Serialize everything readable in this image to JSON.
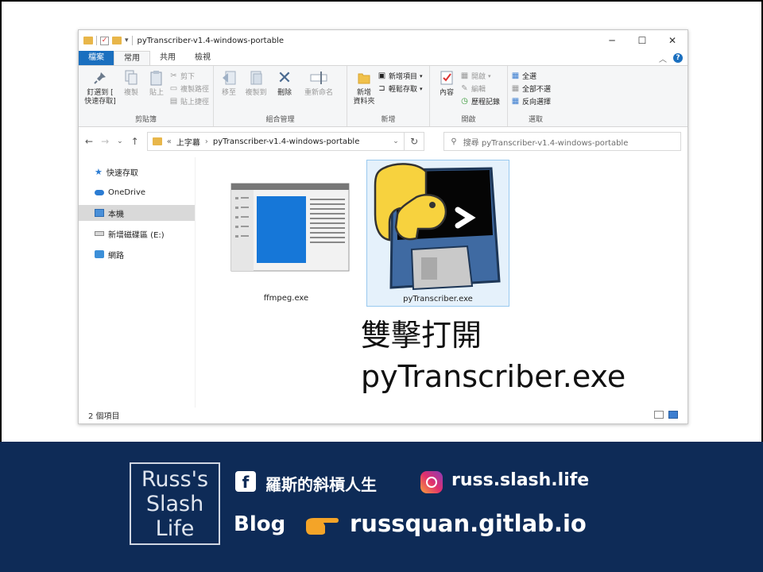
{
  "window": {
    "title": "pyTranscriber-v1.4-windows-portable",
    "controls": {
      "minimize": "─",
      "maximize": "☐",
      "close": "✕"
    }
  },
  "tabs": [
    {
      "label": "檔案"
    },
    {
      "label": "常用"
    },
    {
      "label": "共用"
    },
    {
      "label": "檢視"
    }
  ],
  "ribbon": {
    "clipboard": {
      "label": "剪貼簿",
      "pin": "釘選到 [\n快速存取]",
      "copy": "複製",
      "paste": "貼上",
      "cut": "剪下",
      "copy_path": "複製路徑",
      "paste_shortcut": "貼上捷徑"
    },
    "organize": {
      "label": "組合管理",
      "move_to": "移至",
      "copy_to": "複製到",
      "delete": "刪除",
      "rename": "重新命名"
    },
    "new": {
      "label": "新增",
      "new_folder": "新增\n資料夾",
      "new_item": "新增項目",
      "easy_access": "輕鬆存取"
    },
    "open": {
      "label": "開啟",
      "properties": "內容",
      "open": "開啟",
      "edit": "編輯",
      "history": "歷程記錄"
    },
    "select": {
      "label": "選取",
      "select_all": "全選",
      "select_none": "全部不選",
      "invert": "反向選擇"
    }
  },
  "address": {
    "breadcrumb_prefix": "«",
    "parent": "上字幕",
    "current": "pyTranscriber-v1.4-windows-portable",
    "search_placeholder": "搜尋 pyTranscriber-v1.4-windows-portable"
  },
  "nav_pane": [
    {
      "label": "快速存取",
      "icon": "star-icon"
    },
    {
      "label": "OneDrive",
      "icon": "cloud-icon"
    },
    {
      "label": "本機",
      "icon": "computer-icon"
    },
    {
      "label": "新增磁碟區 (E:)",
      "icon": "drive-icon"
    },
    {
      "label": "網路",
      "icon": "network-icon"
    }
  ],
  "files": [
    {
      "name": "ffmpeg.exe",
      "icon": "application-window-icon"
    },
    {
      "name": "pyTranscriber.exe",
      "icon": "python-floppy-icon"
    }
  ],
  "caption": {
    "line1": "雙擊打開",
    "line2": "pyTranscriber.exe"
  },
  "status": {
    "count": "2 個項目"
  },
  "banner": {
    "logo_line1": "Russ's",
    "logo_line2": "Slash",
    "logo_line3": "Life",
    "facebook_name": "羅斯的斜槓人生",
    "instagram_handle": "russ.slash.life",
    "blog_label": "Blog",
    "blog_url": "russquan.gitlab.io",
    "colors": {
      "banner_bg": "#0e2b57",
      "ribbon_file_tab": "#1a6fbf"
    }
  }
}
